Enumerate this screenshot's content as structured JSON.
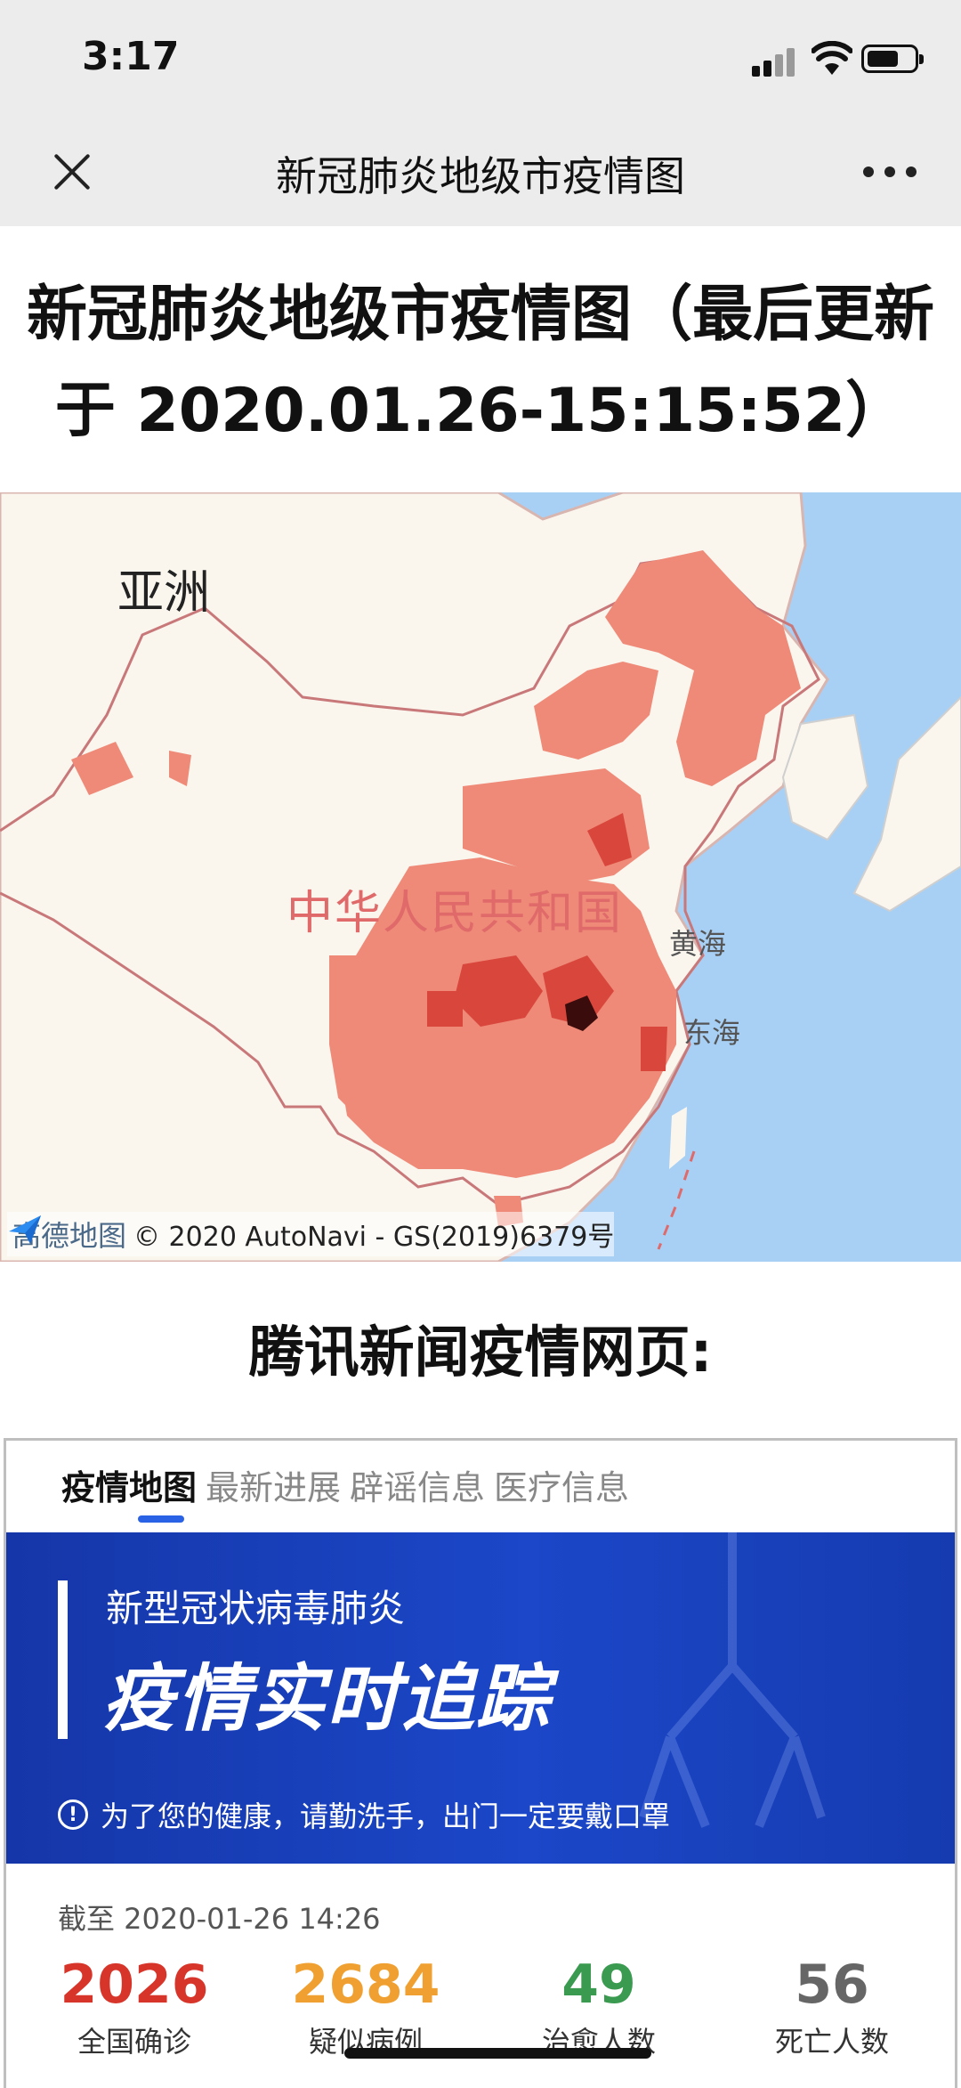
{
  "status_bar": {
    "time": "3:17"
  },
  "nav": {
    "title": "新冠肺炎地级市疫情图"
  },
  "headline": {
    "line1": "新冠肺炎地级市疫情图（最后更新",
    "line2": "于 2020.01.26-15:15:52）"
  },
  "map": {
    "labels": {
      "asia": "亚洲",
      "china": "中华人民共和国",
      "yellow_sea": "黄海",
      "east_sea": "东海"
    },
    "credit": {
      "logo": "高德地图",
      "text": "© 2020 AutoNavi - GS(2019)6379号"
    },
    "colors": {
      "sea": "#a8d0f5",
      "land": "#faf6ee",
      "infected": "#ef8a78",
      "severe": "#c8302a",
      "epicenter": "#3a0c0c"
    }
  },
  "section": {
    "title": "腾讯新闻疫情网页:"
  },
  "embed": {
    "tabs": [
      "疫情地图",
      "最新进展",
      "辟谣信息",
      "医疗信息"
    ],
    "active_tab": "疫情地图",
    "banner": {
      "subtitle": "新型冠状病毒肺炎",
      "title": "疫情实时追踪",
      "note": "为了您的健康，请勤洗手，出门一定要戴口罩"
    },
    "as_of": "截至 2020-01-26 14:26",
    "stats": [
      {
        "value": "2026",
        "label": "全国确诊",
        "color": "#d8352a"
      },
      {
        "value": "2684",
        "label": "疑似病例",
        "color": "#f0a030"
      },
      {
        "value": "49",
        "label": "治愈人数",
        "color": "#3a9a50"
      },
      {
        "value": "56",
        "label": "死亡人数",
        "color": "#666666"
      }
    ]
  }
}
